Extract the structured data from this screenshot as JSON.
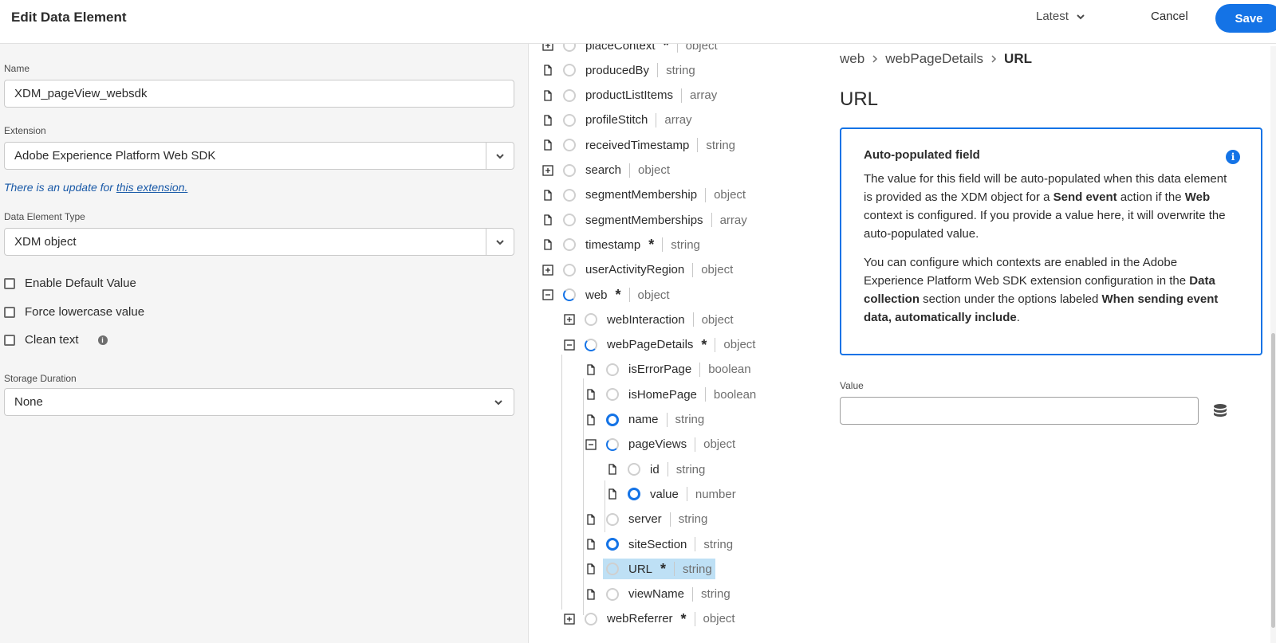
{
  "header": {
    "title": "Edit Data Element",
    "version": "Latest",
    "cancel": "Cancel",
    "save": "Save"
  },
  "form": {
    "name_label": "Name",
    "name_value": "XDM_pageView_websdk",
    "extension_label": "Extension",
    "extension_value": "Adobe Experience Platform Web SDK",
    "update_notice": "There is an update for ",
    "update_link": "this extension.",
    "type_label": "Data Element Type",
    "type_value": "XDM object",
    "checkboxes": [
      "Enable Default Value",
      "Force lowercase value",
      "Clean text"
    ],
    "storage_label": "Storage Duration",
    "storage_value": "None"
  },
  "tree": [
    {
      "name": "placeContext",
      "type": "object",
      "req": true
    },
    {
      "name": "producedBy",
      "type": "string"
    },
    {
      "name": "productListItems",
      "type": "array"
    },
    {
      "name": "profileStitch",
      "type": "array"
    },
    {
      "name": "receivedTimestamp",
      "type": "string"
    },
    {
      "name": "search",
      "type": "object"
    },
    {
      "name": "segmentMembership",
      "type": "object"
    },
    {
      "name": "segmentMemberships",
      "type": "array"
    },
    {
      "name": "timestamp",
      "type": "string",
      "req": true
    },
    {
      "name": "userActivityRegion",
      "type": "object"
    },
    {
      "name": "web",
      "type": "object",
      "req": true
    },
    {
      "name": "webInteraction",
      "type": "object"
    },
    {
      "name": "webPageDetails",
      "type": "object",
      "req": true
    },
    {
      "name": "isErrorPage",
      "type": "boolean"
    },
    {
      "name": "isHomePage",
      "type": "boolean"
    },
    {
      "name": "name",
      "type": "string"
    },
    {
      "name": "pageViews",
      "type": "object"
    },
    {
      "name": "id",
      "type": "string"
    },
    {
      "name": "value",
      "type": "number"
    },
    {
      "name": "server",
      "type": "string"
    },
    {
      "name": "siteSection",
      "type": "string"
    },
    {
      "name": "URL",
      "type": "string",
      "req": true
    },
    {
      "name": "viewName",
      "type": "string"
    },
    {
      "name": "webReferrer",
      "type": "object",
      "req": true
    }
  ],
  "detail": {
    "breadcrumb": [
      "web",
      "webPageDetails",
      "URL"
    ],
    "title": "URL",
    "callout_title": "Auto-populated field",
    "callout_p1_a": "The value for this field will be auto-populated when this data element is provided as the XDM object for a ",
    "callout_p1_b": "Send event",
    "callout_p1_c": " action if the ",
    "callout_p1_d": "Web",
    "callout_p1_e": " context is configured. If you provide a value here, it will overwrite the auto-populated value.",
    "callout_p2_a": "You can configure which contexts are enabled in the Adobe Experience Platform Web SDK extension configuration in the ",
    "callout_p2_b": "Data collection",
    "callout_p2_c": " section under the options labeled ",
    "callout_p2_d": "When sending event data, automatically include",
    "callout_p2_e": ".",
    "value_label": "Value",
    "value_input": ""
  },
  "colors": {
    "accent": "#1473e6",
    "selected_row": "#bee0f5"
  }
}
